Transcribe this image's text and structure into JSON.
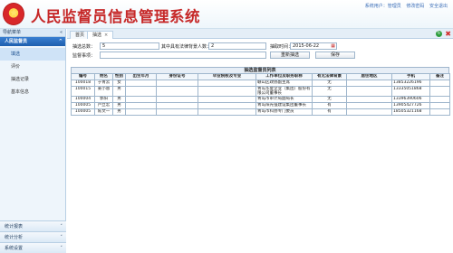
{
  "header": {
    "title": "人民监督员信息管理系统",
    "links": [
      "系统用户：管理员",
      "修改密码",
      "安全退出"
    ]
  },
  "sidebar": {
    "nav_title": "导航菜单",
    "toggle_symbol": "«",
    "group_title": "人民监督员",
    "group_toggle": "^",
    "items": [
      {
        "label": "填选"
      },
      {
        "label": "评价"
      },
      {
        "label": "抽选记录"
      },
      {
        "label": "基本信息"
      }
    ],
    "bottom_groups": [
      {
        "label": "统计报表",
        "toggle": "˅"
      },
      {
        "label": "统计分析",
        "toggle": "˅"
      },
      {
        "label": "系统设置",
        "toggle": "˅"
      }
    ]
  },
  "tabs": [
    {
      "label": "首页"
    },
    {
      "label": "抽选",
      "close": "×"
    }
  ],
  "toolbar": {
    "refresh_icon": "↻",
    "close_icon": "✖"
  },
  "form": {
    "count_label": "抽选总数：",
    "count_value": "5",
    "legal_label": "其中具有法律背景人数：",
    "legal_value": "2",
    "time_label": "抽取时间：",
    "time_value": "2015-06-22",
    "cal_icon": "▦",
    "matter_label": "监督事项：",
    "matter_value": "",
    "redraw_button": "重新抽选",
    "save_button": "保存"
  },
  "table": {
    "caption": "抽选监督员列表",
    "headers": [
      "编号",
      "姓名",
      "性别",
      "出生年月",
      "身份证号",
      "毕业院校及专业",
      "工作单位及职务职称",
      "有无法律背景",
      "居住地区",
      "手机",
      "备注"
    ],
    "rows": [
      [
        "100018",
        "于青云",
        "女",
        "",
        "",
        "",
        "赣山区政协副主席",
        "无",
        "",
        "13853226196",
        ""
      ],
      [
        "100015",
        "姜小蓉",
        "男",
        "",
        "",
        "",
        "青岛华夏企业（集团）股份有限公司董事长",
        "无",
        "",
        "13335051868",
        ""
      ],
      [
        "100004",
        "郭阳",
        "男",
        "",
        "",
        "",
        "青岛市审计局副局长",
        "无",
        "",
        "13396390606",
        ""
      ],
      [
        "100005",
        "芦立宏",
        "男",
        "",
        "",
        "",
        "青岛阳光强建设集团董事长",
        "有",
        "",
        "13905427726",
        ""
      ],
      [
        "100005",
        "陈文一",
        "男",
        "",
        "",
        "",
        "青岛市科协专门委员",
        "有",
        "",
        "18505321168",
        ""
      ]
    ]
  }
}
